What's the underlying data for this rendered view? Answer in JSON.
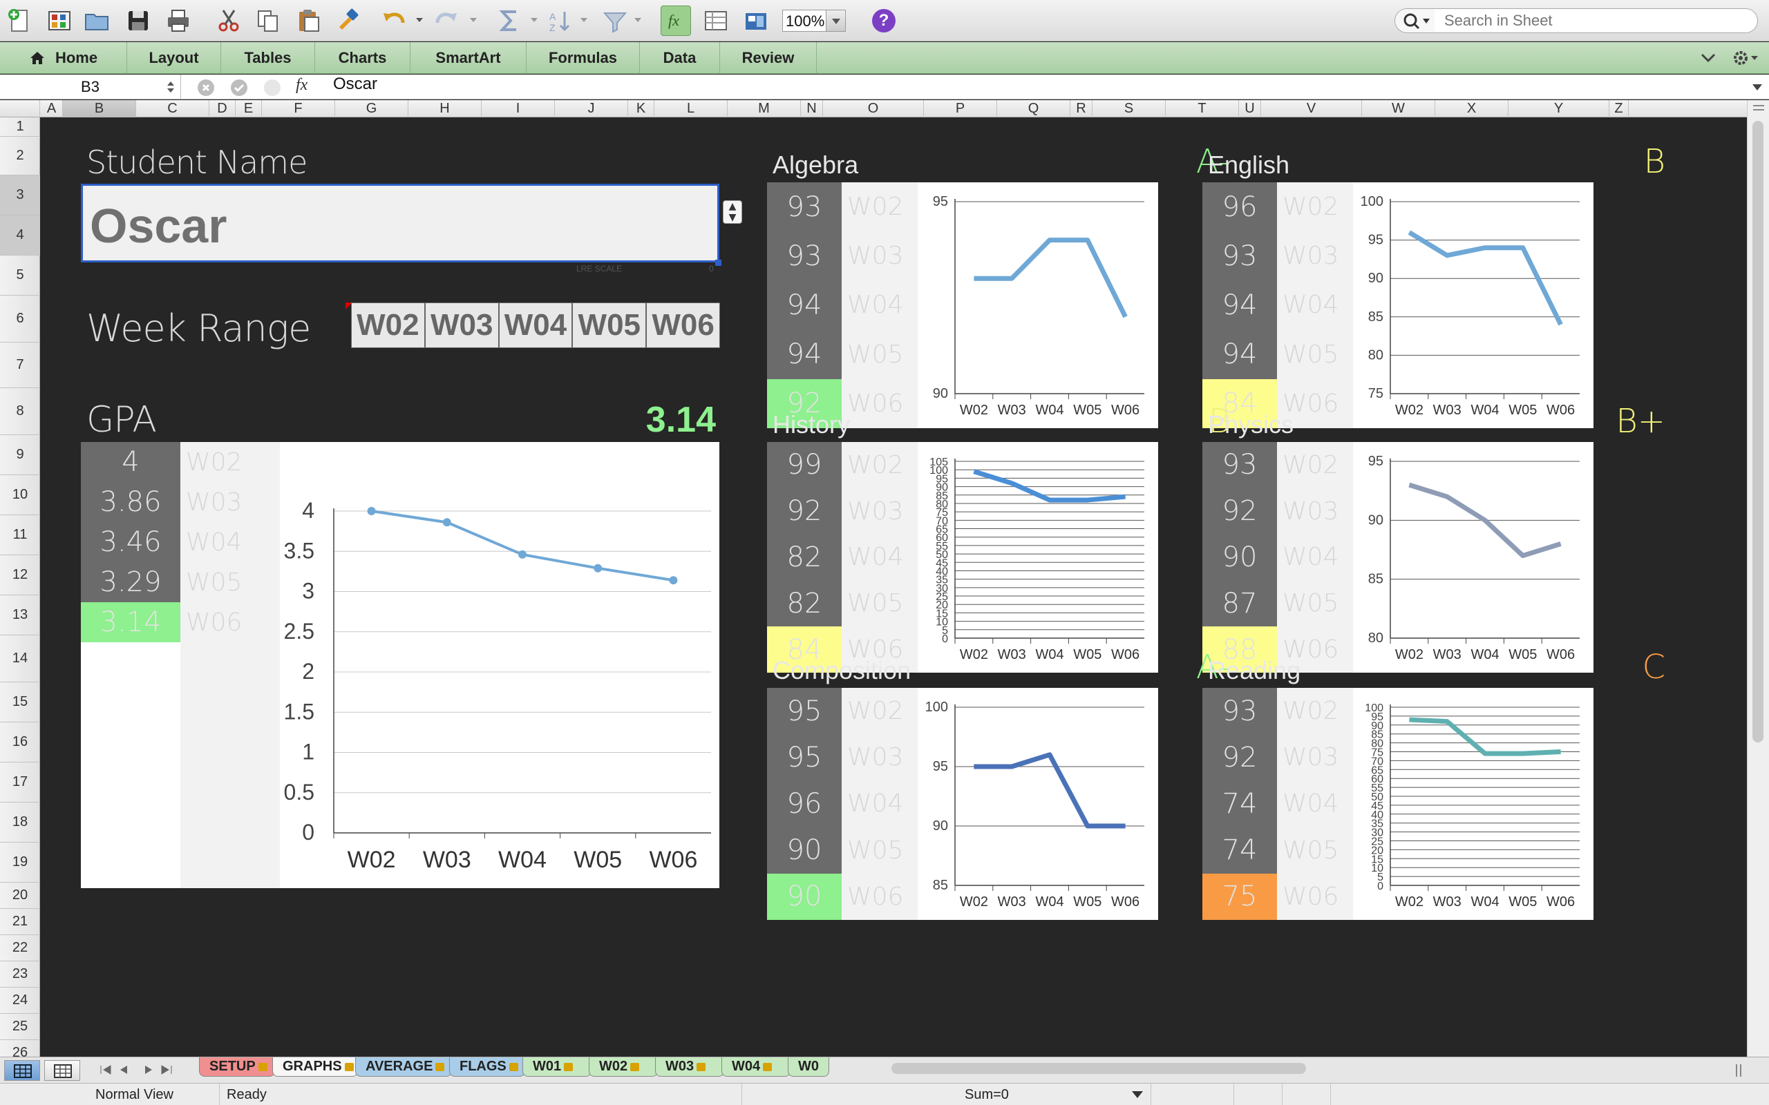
{
  "toolbar": {
    "zoom": "100%",
    "search_placeholder": "Search in Sheet",
    "help": "?"
  },
  "ribbon": {
    "tabs": [
      "Home",
      "Layout",
      "Tables",
      "Charts",
      "SmartArt",
      "Formulas",
      "Data",
      "Review"
    ]
  },
  "formula_bar": {
    "cell_ref": "B3",
    "fx": "fx",
    "value": "Oscar"
  },
  "columns": [
    "A",
    "B",
    "C",
    "D",
    "E",
    "F",
    "G",
    "H",
    "I",
    "J",
    "K",
    "L",
    "M",
    "N",
    "O",
    "P",
    "Q",
    "R",
    "S",
    "T",
    "U",
    "V",
    "W",
    "X",
    "Y",
    "Z"
  ],
  "rows": [
    "1",
    "2",
    "3",
    "4",
    "5",
    "6",
    "7",
    "8",
    "9",
    "10",
    "11",
    "12",
    "13",
    "14",
    "15",
    "16",
    "17",
    "18",
    "19",
    "20",
    "21",
    "22",
    "23",
    "24",
    "25",
    "26"
  ],
  "dashboard": {
    "student_label": "Student Name",
    "student_name": "Oscar",
    "lre_scale": "LRE SCALE",
    "lre_zero": "0",
    "week_range_label": "Week Range",
    "week_range": [
      "W02",
      "W03",
      "W04",
      "W05",
      "W06"
    ],
    "gpa_label": "GPA",
    "gpa_value": "3.14",
    "gpa_weeks": [
      "W02",
      "W03",
      "W04",
      "W05",
      "W06"
    ],
    "gpa_scores": [
      "4",
      "3.86",
      "3.46",
      "3.29",
      "3.14"
    ],
    "highlight_colors": {
      "green": "#8ef08e",
      "yellow": "#fdfd8e",
      "orange": "#f99b45"
    },
    "subjects": {
      "algebra": {
        "title": "Algebra",
        "grade": "A-",
        "grade_color": "#8ef08e",
        "scores": [
          "93",
          "93",
          "94",
          "94",
          "92"
        ],
        "weeks": [
          "W02",
          "W03",
          "W04",
          "W05",
          "W06"
        ],
        "last_color": "#8ef08e"
      },
      "english": {
        "title": "English",
        "grade": "B",
        "grade_color": "#f1f17a",
        "scores": [
          "96",
          "93",
          "94",
          "94",
          "84"
        ],
        "weeks": [
          "W02",
          "W03",
          "W04",
          "W05",
          "W06"
        ],
        "last_color": "#fdfd8e"
      },
      "history": {
        "title": "History",
        "grade": "B",
        "grade_color": "#f1f17a",
        "scores": [
          "99",
          "92",
          "82",
          "82",
          "84"
        ],
        "weeks": [
          "W02",
          "W03",
          "W04",
          "W05",
          "W06"
        ],
        "last_color": "#fdfd8e"
      },
      "physics": {
        "title": "Physics",
        "grade": "B+",
        "grade_color": "#f1f17a",
        "scores": [
          "93",
          "92",
          "90",
          "87",
          "88"
        ],
        "weeks": [
          "W02",
          "W03",
          "W04",
          "W05",
          "W06"
        ],
        "last_color": "#fdfd8e"
      },
      "composition": {
        "title": "Composition",
        "grade": "A-",
        "grade_color": "#8ef08e",
        "scores": [
          "95",
          "95",
          "96",
          "90",
          "90"
        ],
        "weeks": [
          "W02",
          "W03",
          "W04",
          "W05",
          "W06"
        ],
        "last_color": "#8ef08e"
      },
      "reading": {
        "title": "Reading",
        "grade": "C",
        "grade_color": "#f99b45",
        "scores": [
          "93",
          "92",
          "74",
          "74",
          "75"
        ],
        "weeks": [
          "W02",
          "W03",
          "W04",
          "W05",
          "W06"
        ],
        "last_color": "#f99b45"
      }
    }
  },
  "chart_data": [
    {
      "type": "line",
      "id": "gpa",
      "categories": [
        "W02",
        "W03",
        "W04",
        "W05",
        "W06"
      ],
      "values": [
        4,
        3.86,
        3.46,
        3.29,
        3.14
      ],
      "ylim": [
        0,
        4
      ],
      "yticks": [
        "0",
        "0.5",
        "1",
        "1.5",
        "2",
        "2.5",
        "3",
        "3.5",
        "4"
      ],
      "color": "#6fa8d6",
      "markers": true
    },
    {
      "type": "line",
      "id": "algebra",
      "categories": [
        "W02",
        "W03",
        "W04",
        "W05",
        "W06"
      ],
      "values": [
        93,
        93,
        94,
        94,
        92
      ],
      "ylim": [
        90,
        95
      ],
      "yticks": [
        "90",
        "95"
      ],
      "color": "#6fa8d6"
    },
    {
      "type": "line",
      "id": "english",
      "categories": [
        "W02",
        "W03",
        "W04",
        "W05",
        "W06"
      ],
      "values": [
        96,
        93,
        94,
        94,
        84
      ],
      "ylim": [
        75,
        100
      ],
      "yticks": [
        "75",
        "80",
        "85",
        "90",
        "95",
        "100"
      ],
      "color": "#6fa8d6"
    },
    {
      "type": "line",
      "id": "history",
      "categories": [
        "W02",
        "W03",
        "W04",
        "W05",
        "W06"
      ],
      "values": [
        99,
        92,
        82,
        82,
        84
      ],
      "ylim": [
        0,
        105
      ],
      "yticks": [
        "0",
        "5",
        "10",
        "15",
        "20",
        "25",
        "30",
        "35",
        "40",
        "45",
        "50",
        "55",
        "60",
        "65",
        "70",
        "75",
        "80",
        "85",
        "90",
        "95",
        "100",
        "105"
      ],
      "color": "#4a8fd6"
    },
    {
      "type": "line",
      "id": "physics",
      "categories": [
        "W02",
        "W03",
        "W04",
        "W05",
        "W06"
      ],
      "values": [
        93,
        92,
        90,
        87,
        88
      ],
      "ylim": [
        80,
        95
      ],
      "yticks": [
        "80",
        "85",
        "90",
        "95"
      ],
      "color": "#8e9cb5"
    },
    {
      "type": "line",
      "id": "composition",
      "categories": [
        "W02",
        "W03",
        "W04",
        "W05",
        "W06"
      ],
      "values": [
        95,
        95,
        96,
        90,
        90
      ],
      "ylim": [
        85,
        100
      ],
      "yticks": [
        "85",
        "90",
        "95",
        "100"
      ],
      "color": "#4a72b8"
    },
    {
      "type": "line",
      "id": "reading",
      "categories": [
        "W02",
        "W03",
        "W04",
        "W05",
        "W06"
      ],
      "values": [
        93,
        92,
        74,
        74,
        75
      ],
      "ylim": [
        0,
        100
      ],
      "yticks": [
        "0",
        "5",
        "10",
        "15",
        "20",
        "25",
        "30",
        "35",
        "40",
        "45",
        "50",
        "55",
        "60",
        "65",
        "70",
        "75",
        "80",
        "85",
        "90",
        "95",
        "100"
      ],
      "color": "#5fb0b0"
    }
  ],
  "sheet_tabs": [
    {
      "label": "SETUP",
      "color": "#f08f8f"
    },
    {
      "label": "GRAPHS",
      "color": "#e4e4e4"
    },
    {
      "label": "AVERAGE",
      "color": "#a9cde8"
    },
    {
      "label": "FLAGS",
      "color": "#a9cde8"
    },
    {
      "label": "W01",
      "color": "#c5e8c0"
    },
    {
      "label": "W02",
      "color": "#c5e8c0"
    },
    {
      "label": "W03",
      "color": "#c5e8c0"
    },
    {
      "label": "W04",
      "color": "#c5e8c0"
    },
    {
      "label": "W0",
      "color": "#c5e8c0"
    }
  ],
  "status": {
    "view": "Normal View",
    "state": "Ready",
    "sum": "Sum=0"
  }
}
